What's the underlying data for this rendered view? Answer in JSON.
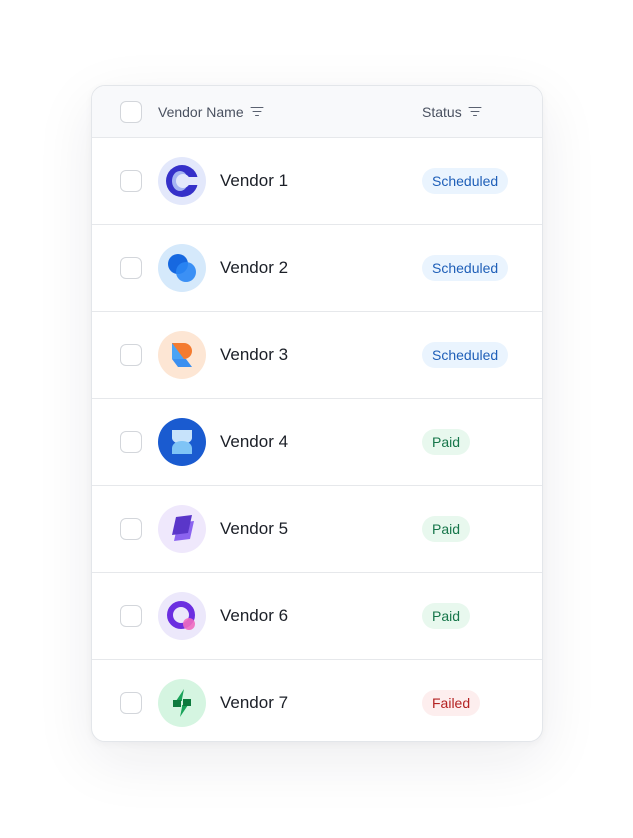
{
  "table": {
    "columns": [
      {
        "label": "Vendor Name",
        "icon": "filter-icon"
      },
      {
        "label": "Status",
        "icon": "filter-icon"
      }
    ],
    "rows": [
      {
        "name": "Vendor 1",
        "status": "Scheduled",
        "logo": "vendor1-logo-icon"
      },
      {
        "name": "Vendor 2",
        "status": "Scheduled",
        "logo": "vendor2-logo-icon"
      },
      {
        "name": "Vendor 3",
        "status": "Scheduled",
        "logo": "vendor3-logo-icon"
      },
      {
        "name": "Vendor 4",
        "status": "Paid",
        "logo": "vendor4-logo-icon"
      },
      {
        "name": "Vendor 5",
        "status": "Paid",
        "logo": "vendor5-logo-icon"
      },
      {
        "name": "Vendor 6",
        "status": "Paid",
        "logo": "vendor6-logo-icon"
      },
      {
        "name": "Vendor 7",
        "status": "Failed",
        "logo": "vendor7-logo-icon"
      }
    ]
  },
  "status_colors": {
    "Scheduled": {
      "bg": "#eaf4fe",
      "fg": "#1f5fb8"
    },
    "Paid": {
      "bg": "#e8f8ee",
      "fg": "#16764a"
    },
    "Failed": {
      "bg": "#fdeeee",
      "fg": "#b42323"
    }
  }
}
